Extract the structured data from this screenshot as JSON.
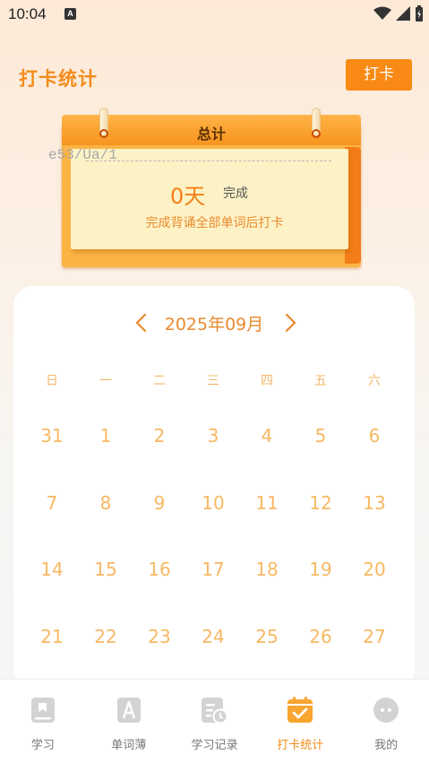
{
  "status": {
    "time": "10:04",
    "notification": "A"
  },
  "header": {
    "title": "打卡统计",
    "checkin_button": "打卡"
  },
  "summary": {
    "title": "总计",
    "id_text": "e53/Ua/1",
    "days_value": "0天",
    "days_label": "完成",
    "hint": "完成背诵全部单词后打卡"
  },
  "calendar": {
    "month": "2025年09月",
    "weekdays": [
      "日",
      "一",
      "二",
      "三",
      "四",
      "五",
      "六"
    ],
    "days": [
      [
        "31",
        "1",
        "2",
        "3",
        "4",
        "5",
        "6"
      ],
      [
        "7",
        "8",
        "9",
        "10",
        "11",
        "12",
        "13"
      ],
      [
        "14",
        "15",
        "16",
        "17",
        "18",
        "19",
        "20"
      ],
      [
        "21",
        "22",
        "23",
        "24",
        "25",
        "26",
        "27"
      ]
    ]
  },
  "tabs": [
    {
      "label": "学习",
      "icon": "book-icon",
      "active": false
    },
    {
      "label": "单词薄",
      "icon": "wordbook-icon",
      "active": false
    },
    {
      "label": "学习记录",
      "icon": "record-icon",
      "active": false
    },
    {
      "label": "打卡统计",
      "icon": "calendar-check-icon",
      "active": true
    },
    {
      "label": "我的",
      "icon": "profile-icon",
      "active": false
    }
  ],
  "colors": {
    "accent": "#f88a15",
    "calendar_day": "#f7b862",
    "tab_inactive": "#777777"
  }
}
